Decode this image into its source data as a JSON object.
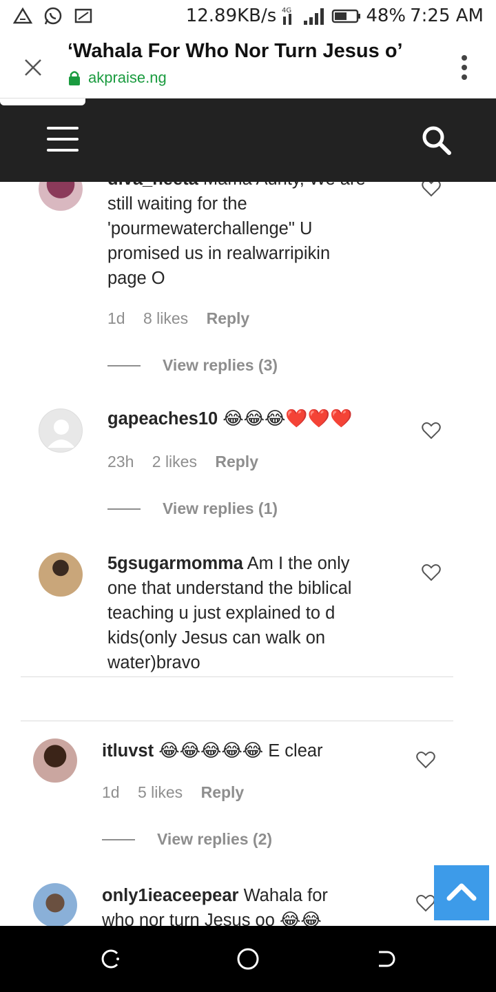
{
  "status_bar": {
    "network_speed": "12.89KB/s",
    "network_type": "4G",
    "battery": "48%",
    "time": "7:25 AM"
  },
  "browser": {
    "title": "‘Wahala For Who Nor Turn Jesus o’",
    "domain": "akpraise.ng"
  },
  "comments": [
    {
      "username": "diva_neeta",
      "text_line0": "Mama Aunty, We are",
      "text_lines": [
        "still waiting for the",
        "'pourmewaterchallenge\" U",
        "promised us in realwarripikin",
        "page O"
      ],
      "time": "1d",
      "likes": "8 likes",
      "reply": "Reply",
      "view_replies": "View replies (3)"
    },
    {
      "username": "gapeaches10",
      "emojis": "😂😂😂❤️❤️❤️",
      "time": "23h",
      "likes": "2 likes",
      "reply": "Reply",
      "view_replies": "View replies (1)"
    },
    {
      "username": "5gsugarmomma",
      "text_first": "Am I the only",
      "text_lines": [
        "one that understand the biblical",
        "teaching u just explained to d",
        "kids(only Jesus can walk on",
        "water)bravo"
      ]
    },
    {
      "username": "itluvst",
      "emojis": "😂😂😂😂😂",
      "text": "E clear",
      "time": "1d",
      "likes": "5 likes",
      "reply": "Reply",
      "view_replies": "View replies (2)"
    },
    {
      "username": "only1ieaceepear",
      "text_first": "Wahala for",
      "text_line2": "who nor turn Jesus oo",
      "emojis": "😂😂"
    }
  ],
  "icons": {
    "close": "close-icon",
    "lock": "lock-icon",
    "menu": "more-vert-icon",
    "hamburger": "hamburger-icon",
    "search": "search-icon",
    "heart": "heart-icon",
    "back_to_top": "chevron-up-icon"
  },
  "colors": {
    "nav_bg": "#222222",
    "domain_green": "#1a9b3f",
    "back_top_blue": "#3d9be9"
  }
}
